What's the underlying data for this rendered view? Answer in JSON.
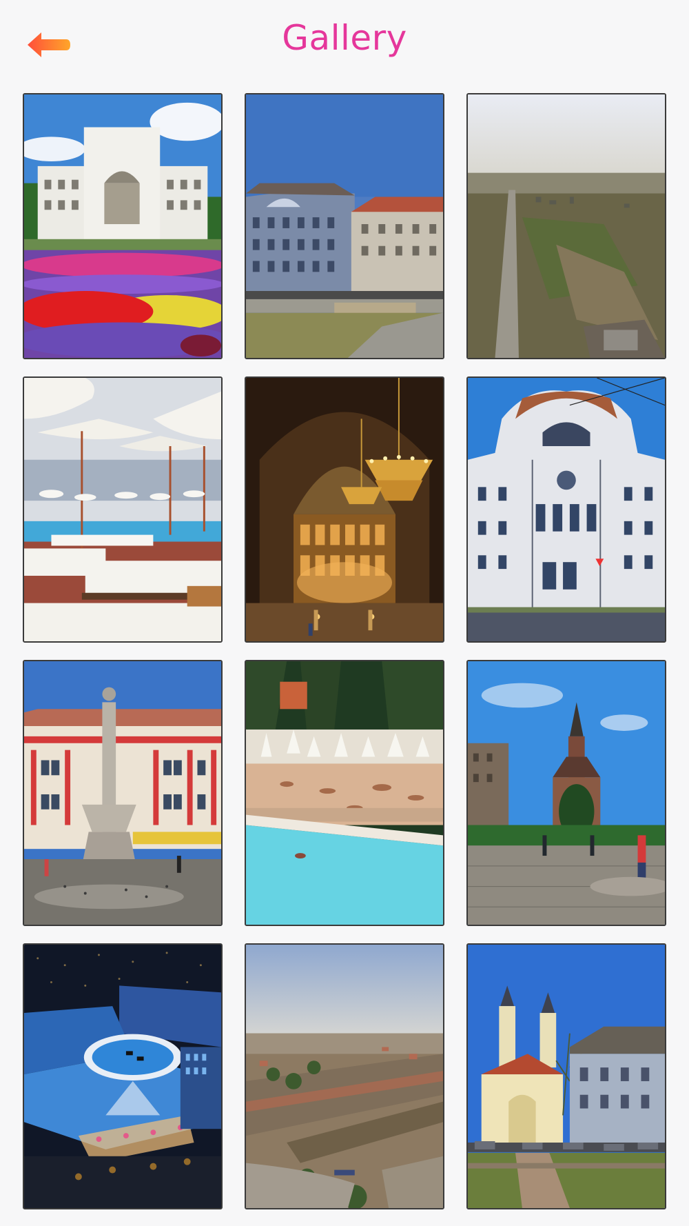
{
  "header": {
    "title": "Gallery",
    "back_icon": "back-arrow-icon",
    "title_color": "#e5379b",
    "back_arrow_colors": [
      "#ff5a3a",
      "#ffa12a"
    ]
  },
  "gallery": {
    "photos": [
      {
        "name": "opera-house-flowers"
      },
      {
        "name": "blue-baroque-palace"
      },
      {
        "name": "aerial-city-outskirts"
      },
      {
        "name": "pool-umbrellas-loungers"
      },
      {
        "name": "cathedral-interior-chandelier"
      },
      {
        "name": "art-nouveau-palace"
      },
      {
        "name": "statue-column-square"
      },
      {
        "name": "thermal-pool-crowd"
      },
      {
        "name": "orthodox-cathedral-square"
      },
      {
        "name": "shopping-mall-night-render"
      },
      {
        "name": "aerial-railway-yard"
      },
      {
        "name": "church-twin-towers"
      }
    ]
  }
}
